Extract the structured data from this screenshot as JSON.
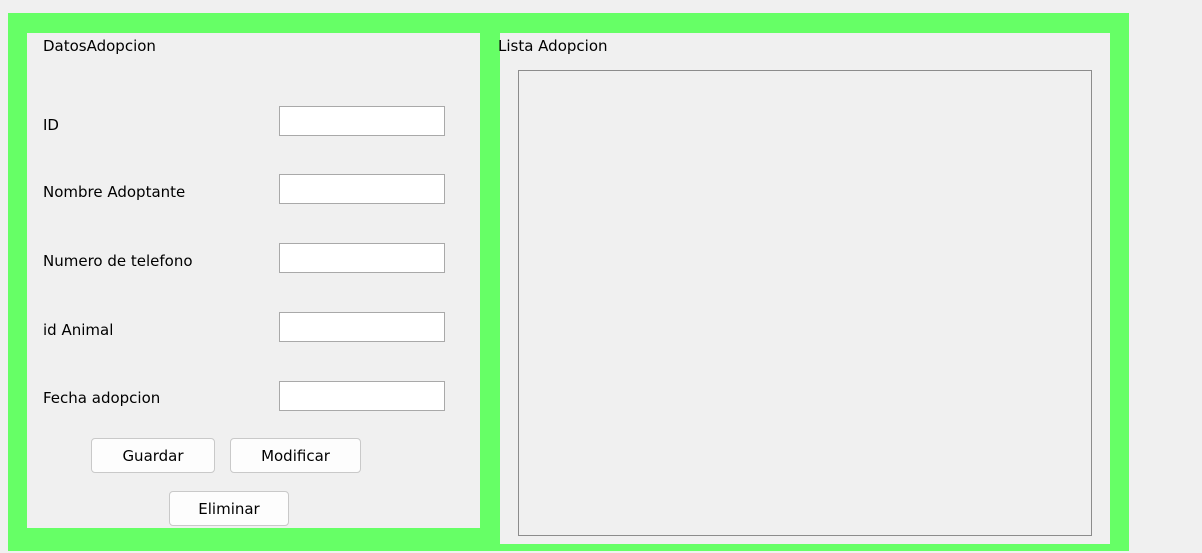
{
  "datos_panel": {
    "title": "DatosAdopcion",
    "fields": [
      {
        "label": "ID",
        "value": ""
      },
      {
        "label": "Nombre Adoptante",
        "value": ""
      },
      {
        "label": "Numero de telefono",
        "value": ""
      },
      {
        "label": "id Animal",
        "value": ""
      },
      {
        "label": "Fecha adopcion",
        "value": ""
      }
    ],
    "buttons": {
      "guardar": "Guardar",
      "modificar": "Modificar",
      "eliminar": "Eliminar"
    }
  },
  "lista_panel": {
    "title": "Lista Adopcion",
    "items": []
  },
  "colors": {
    "frame_green": "#66ff66",
    "panel_background": "#f0f0f0"
  }
}
